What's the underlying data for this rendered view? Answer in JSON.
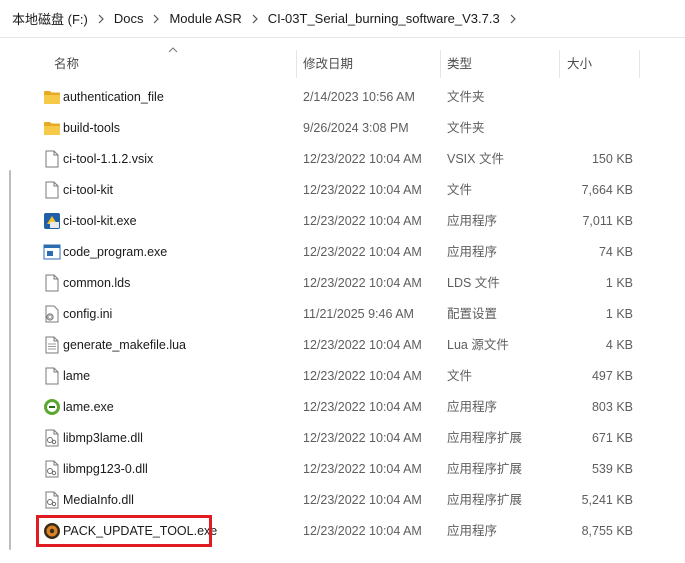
{
  "breadcrumb": [
    "本地磁盘 (F:)",
    "Docs",
    "Module ASR",
    "CI-03T_Serial_burning_software_V3.7.3"
  ],
  "columns": {
    "name": "名称",
    "date": "修改日期",
    "type": "类型",
    "size": "大小"
  },
  "files": [
    {
      "icon": "folder-icon",
      "name": "authentication_file",
      "date": "2/14/2023 10:56 AM",
      "type": "文件夹",
      "size": ""
    },
    {
      "icon": "folder-icon",
      "name": "build-tools",
      "date": "9/26/2024 3:08 PM",
      "type": "文件夹",
      "size": ""
    },
    {
      "icon": "file-icon",
      "name": "ci-tool-1.1.2.vsix",
      "date": "12/23/2022 10:04 AM",
      "type": "VSIX 文件",
      "size": "150 KB"
    },
    {
      "icon": "file-icon",
      "name": "ci-tool-kit",
      "date": "12/23/2022 10:04 AM",
      "type": "文件",
      "size": "7,664 KB"
    },
    {
      "icon": "exe-app-icon",
      "name": "ci-tool-kit.exe",
      "date": "12/23/2022 10:04 AM",
      "type": "应用程序",
      "size": "7,011 KB"
    },
    {
      "icon": "exe-window-icon",
      "name": "code_program.exe",
      "date": "12/23/2022 10:04 AM",
      "type": "应用程序",
      "size": "74 KB"
    },
    {
      "icon": "file-icon",
      "name": "common.lds",
      "date": "12/23/2022 10:04 AM",
      "type": "LDS 文件",
      "size": "1 KB"
    },
    {
      "icon": "config-file-icon",
      "name": "config.ini",
      "date": "11/21/2025 9:46 AM",
      "type": "配置设置",
      "size": "1 KB"
    },
    {
      "icon": "text-file-icon",
      "name": "generate_makefile.lua",
      "date": "12/23/2022 10:04 AM",
      "type": "Lua 源文件",
      "size": "4 KB"
    },
    {
      "icon": "file-icon",
      "name": "lame",
      "date": "12/23/2022 10:04 AM",
      "type": "文件",
      "size": "497 KB"
    },
    {
      "icon": "lame-exe-icon",
      "name": "lame.exe",
      "date": "12/23/2022 10:04 AM",
      "type": "应用程序",
      "size": "803 KB"
    },
    {
      "icon": "dll-icon",
      "name": "libmp3lame.dll",
      "date": "12/23/2022 10:04 AM",
      "type": "应用程序扩展",
      "size": "671 KB"
    },
    {
      "icon": "dll-icon",
      "name": "libmpg123-0.dll",
      "date": "12/23/2022 10:04 AM",
      "type": "应用程序扩展",
      "size": "539 KB"
    },
    {
      "icon": "dll-icon",
      "name": "MediaInfo.dll",
      "date": "12/23/2022 10:04 AM",
      "type": "应用程序扩展",
      "size": "5,241 KB"
    },
    {
      "icon": "pack-tool-icon",
      "name": "PACK_UPDATE_TOOL.exe",
      "date": "12/23/2022 10:04 AM",
      "type": "应用程序",
      "size": "8,755 KB"
    }
  ],
  "colors": {
    "folder": "#f7c948",
    "highlight": "#e11b22"
  }
}
